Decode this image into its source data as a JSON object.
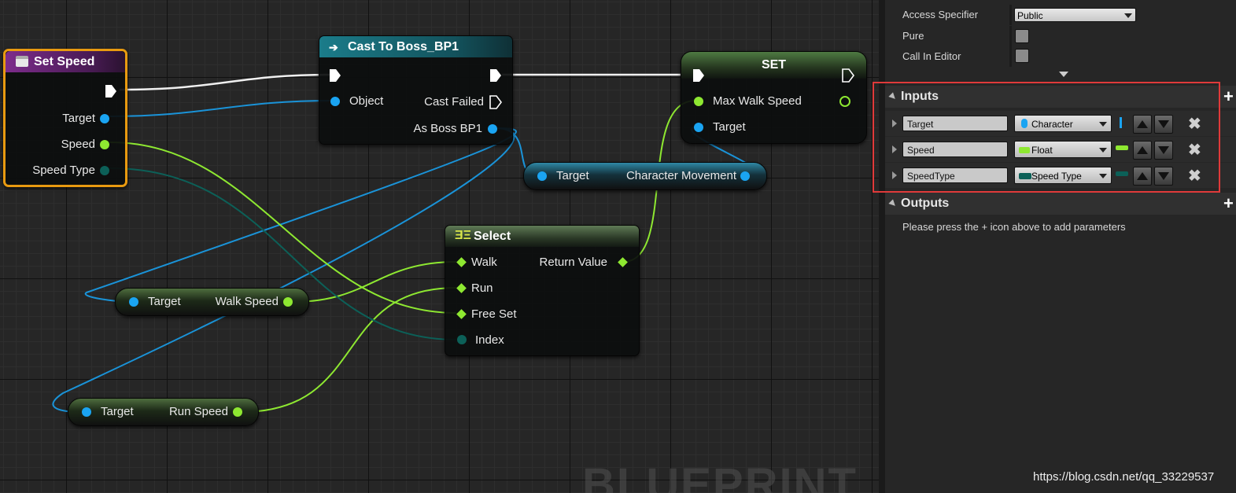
{
  "graph": {
    "watermark": "BLUEPRINT",
    "nodes": {
      "set_speed": {
        "title": "Set Speed",
        "pins": [
          "Target",
          "Speed",
          "Speed Type"
        ]
      },
      "cast": {
        "title": "Cast To Boss_BP1",
        "pins": [
          "Object",
          "Cast Failed",
          "As Boss BP1"
        ]
      },
      "set": {
        "title": "SET",
        "pins": [
          "Max Walk Speed",
          "Target"
        ]
      },
      "char_move": {
        "target": "Target",
        "output": "Character Movement"
      },
      "select": {
        "title": "Select",
        "pins": [
          "Walk",
          "Run",
          "Free Set",
          "Index"
        ],
        "output": "Return Value"
      },
      "walk_speed": {
        "target": "Target",
        "output": "Walk Speed"
      },
      "run_speed": {
        "target": "Target",
        "output": "Run Speed"
      }
    }
  },
  "details": {
    "access_specifier": {
      "label": "Access Specifier",
      "value": "Public"
    },
    "pure": {
      "label": "Pure",
      "checked": false
    },
    "call_in_editor": {
      "label": "Call In Editor",
      "checked": false
    },
    "inputs": {
      "title": "Inputs",
      "items": [
        {
          "name": "Target",
          "type": "Character",
          "color": "#1aa4f2"
        },
        {
          "name": "Speed",
          "type": "Float",
          "color": "#8ee831"
        },
        {
          "name": "SpeedType",
          "type": "Speed Type",
          "color": "#0c6058"
        }
      ]
    },
    "outputs": {
      "title": "Outputs",
      "hint": "Please press the + icon above to add parameters"
    }
  },
  "watermark_url": "https://blog.csdn.net/qq_33229537",
  "colors": {
    "object": "#1aa4f2",
    "float": "#8ee831",
    "enum": "#0c6058",
    "highlight": "#e03a3a",
    "selection": "#e89a10"
  }
}
